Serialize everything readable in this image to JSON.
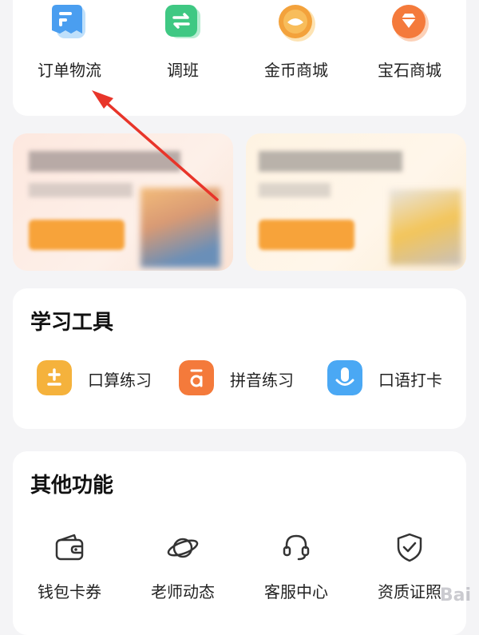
{
  "quick_actions": [
    {
      "label": "订单物流",
      "icon": "order-logistics-icon"
    },
    {
      "label": "调班",
      "icon": "switch-class-icon"
    },
    {
      "label": "金币商城",
      "icon": "coin-mall-icon"
    },
    {
      "label": "宝石商城",
      "icon": "gem-mall-icon"
    }
  ],
  "tools": {
    "title": "学习工具",
    "items": [
      {
        "label": "口算练习",
        "icon": "plus-minus-icon"
      },
      {
        "label": "拼音练习",
        "icon": "pinyin-icon"
      },
      {
        "label": "口语打卡",
        "icon": "microphone-icon"
      }
    ]
  },
  "other": {
    "title": "其他功能",
    "items": [
      {
        "label": "钱包卡券",
        "icon": "wallet-icon"
      },
      {
        "label": "老师动态",
        "icon": "planet-icon"
      },
      {
        "label": "客服中心",
        "icon": "headset-icon"
      },
      {
        "label": "资质证照",
        "icon": "shield-check-icon"
      }
    ]
  },
  "colors": {
    "blue": "#4a9ef0",
    "green": "#3fc883",
    "gold": "#f3a23c",
    "orange": "#f47a3b",
    "annotation_red": "#e8352a"
  }
}
